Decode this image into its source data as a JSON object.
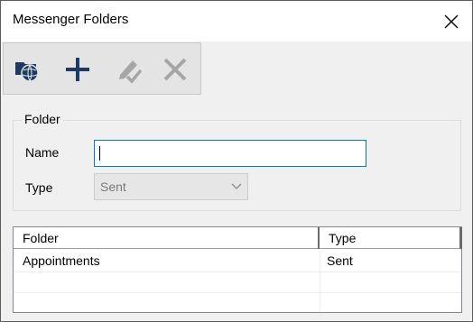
{
  "window": {
    "title": "Messenger Folders"
  },
  "toolbar": {
    "buttons": [
      {
        "name": "open-folders-button",
        "icon": "folder-globe-icon",
        "enabled": true
      },
      {
        "name": "add-button",
        "icon": "plus-icon",
        "enabled": true
      },
      {
        "name": "edit-button",
        "icon": "pencil-check-icon",
        "enabled": false
      },
      {
        "name": "delete-button",
        "icon": "x-icon",
        "enabled": false
      }
    ]
  },
  "folder_group": {
    "label": "Folder",
    "name_label": "Name",
    "name_value": "",
    "type_label": "Type",
    "type_value": "Sent"
  },
  "list": {
    "columns": [
      "Folder",
      "Type"
    ],
    "rows": [
      {
        "folder": "Appointments",
        "type": "Sent"
      }
    ]
  },
  "colors": {
    "accent_blue": "#0078d7",
    "icon_navy": "#1c3a63",
    "disabled_icon": "#a6a6a6"
  }
}
